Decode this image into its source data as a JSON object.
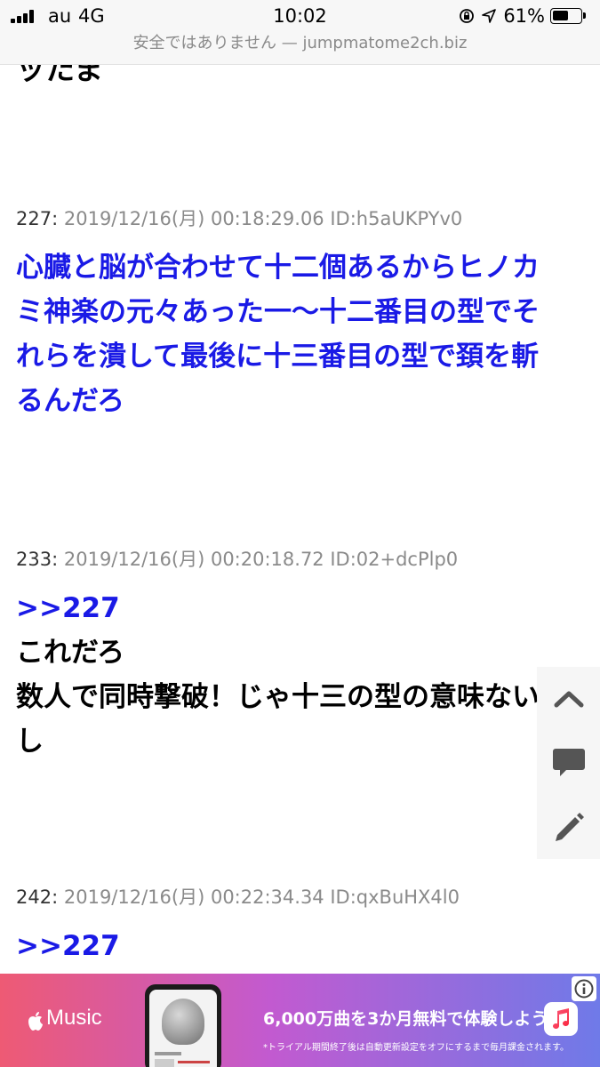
{
  "status_bar": {
    "carrier": "au",
    "network": "4G",
    "time": "10:02",
    "battery_percent": "61%",
    "battery_level": 0.61
  },
  "url_bar": {
    "text": "安全ではありません — jumpmatome2ch.biz"
  },
  "top_cut_text": "ッたま",
  "posts": [
    {
      "number": "227:",
      "meta": "2019/12/16(月) 00:18:29.06 ID:h5aUKPYv0",
      "lines": [
        "心臓と脳が合わせて十二個あるからヒノカ",
        "ミ神楽の元々あった一～十二番目の型でそ",
        "れらを潰して最後に十三番目の型で頚を斬",
        "るんだろ"
      ]
    },
    {
      "number": "233:",
      "meta": "2019/12/16(月) 00:20:18.72 ID:02+dcPlp0",
      "anchor": ">>227",
      "lines": [
        "これだろ",
        "数人で同時撃破！じゃ十三の型の意味ない",
        "し"
      ]
    },
    {
      "number": "242:",
      "meta": "2019/12/16(月) 00:22:34.34 ID:qxBuHX4l0",
      "anchor": ">>227"
    }
  ],
  "side_tools": {
    "icons": [
      "chevron-up-icon",
      "comment-icon",
      "pencil-icon"
    ]
  },
  "ad": {
    "brand": "Music",
    "headline": "6,000万曲を3か月無料で体験しよう。",
    "note": "*トライアル期間終了後は自動更新設定をオフにするまで毎月課金されます。",
    "colors": {
      "start": "#ee5a74",
      "mid": "#c25ad0",
      "end": "#6f7ae8"
    }
  },
  "colors": {
    "post_blue": "#1a1ae6",
    "meta_gray": "#8a8a8a"
  }
}
